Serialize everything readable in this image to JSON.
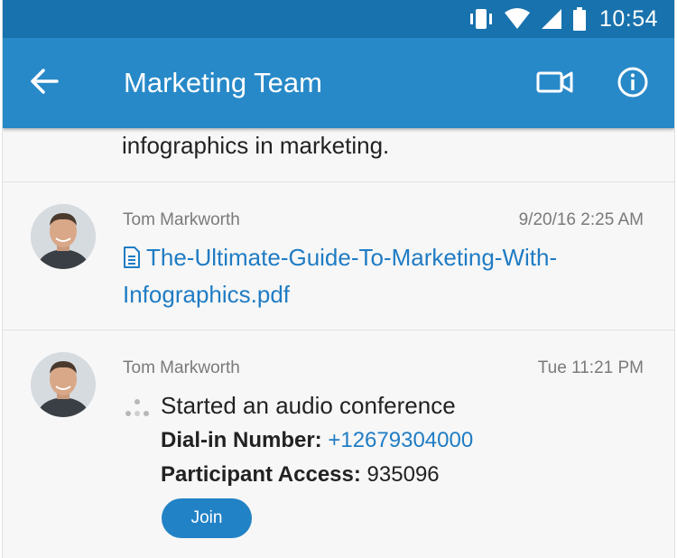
{
  "status_bar": {
    "time": "10:54",
    "icons": [
      "vibrate-icon",
      "wifi-icon",
      "signal-icon",
      "battery-icon"
    ]
  },
  "app_bar": {
    "title": "Marketing Team",
    "icons": [
      "back-arrow-icon",
      "video-call-icon",
      "info-icon"
    ]
  },
  "messages": {
    "partial": {
      "text": "infographics in marketing."
    },
    "file_message": {
      "sender": "Tom Markworth",
      "time": "9/20/16 2:25 AM",
      "file_name": "The-Ultimate-Guide-To-Marketing-With-Infographics.pdf"
    },
    "conference_message": {
      "sender": "Tom Markworth",
      "time": "Tue 11:21 PM",
      "text": "Started an audio conference",
      "dial_in_label": "Dial-in Number:",
      "dial_in_number": "+12679304000",
      "access_label": "Participant Access:",
      "access_code": "935096",
      "join_label": "Join"
    }
  },
  "colors": {
    "status_bar": "#1872ad",
    "app_bar": "#2889c8",
    "link": "#1f7cc4",
    "join_button": "#2282c6"
  }
}
